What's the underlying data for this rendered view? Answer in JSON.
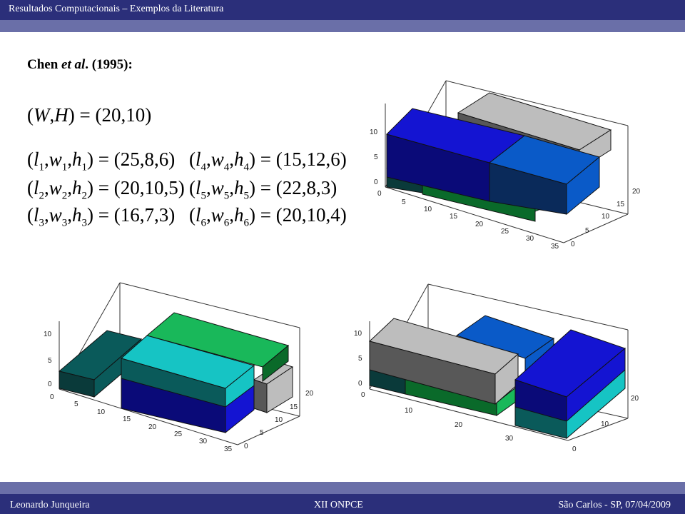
{
  "header": {
    "title": "Resultados Computacionais – Exemplos da Literatura"
  },
  "slide": {
    "heading_prefix": "Chen ",
    "heading_italic": "et al",
    "heading_suffix": ". (1995):"
  },
  "equations": {
    "container": {
      "lhs": "(W,H)",
      "rhs": "= (20,10)"
    },
    "boxes": [
      {
        "lhs": "(l1,w1,h1)",
        "rhs": "= (25,8,6)"
      },
      {
        "lhs": "(l2,w2,h2)",
        "rhs": "= (20,10,5)"
      },
      {
        "lhs": "(l3,w3,h3)",
        "rhs": "= (16,7,3)"
      },
      {
        "lhs": "(l4,w4,h4)",
        "rhs": "= (15,12,6)"
      },
      {
        "lhs": "(l5,w5,h5)",
        "rhs": "= (22,8,3)"
      },
      {
        "lhs": "(l6,w6,h6)",
        "rhs": "= (20,10,4)"
      }
    ]
  },
  "plots": [
    {
      "name": "plot-top-right",
      "z_ticks": [
        "0",
        "5",
        "10"
      ],
      "x_ticks": [
        "0",
        "5",
        "10",
        "15",
        "20",
        "25",
        "30",
        "35"
      ],
      "y_ticks": [
        "0",
        "5",
        "10",
        "15",
        "20"
      ]
    },
    {
      "name": "plot-bottom-left",
      "z_ticks": [
        "0",
        "5",
        "10"
      ],
      "x_ticks": [
        "0",
        "5",
        "10",
        "15",
        "20",
        "25",
        "30",
        "35"
      ],
      "y_ticks": [
        "0",
        "5",
        "10",
        "15",
        "20"
      ]
    },
    {
      "name": "plot-bottom-right",
      "z_ticks": [
        "0",
        "5",
        "10"
      ],
      "x_ticks": [
        "0",
        "10",
        "20",
        "30"
      ],
      "y_ticks": [
        "0",
        "10",
        "20"
      ]
    }
  ],
  "colors": {
    "dark_teal": "#0a5a5a",
    "teal": "#16c4c4",
    "green": "#19b85a",
    "navy": "#0a0a78",
    "blue": "#1414d2",
    "mid_blue": "#0a5ac8",
    "gray": "#585858",
    "light_gray": "#bdbdbd"
  },
  "footer": {
    "author": "Leonardo Junqueira",
    "event": "XII ONPCE",
    "place_date": "São Carlos - SP, 07/04/2009"
  }
}
